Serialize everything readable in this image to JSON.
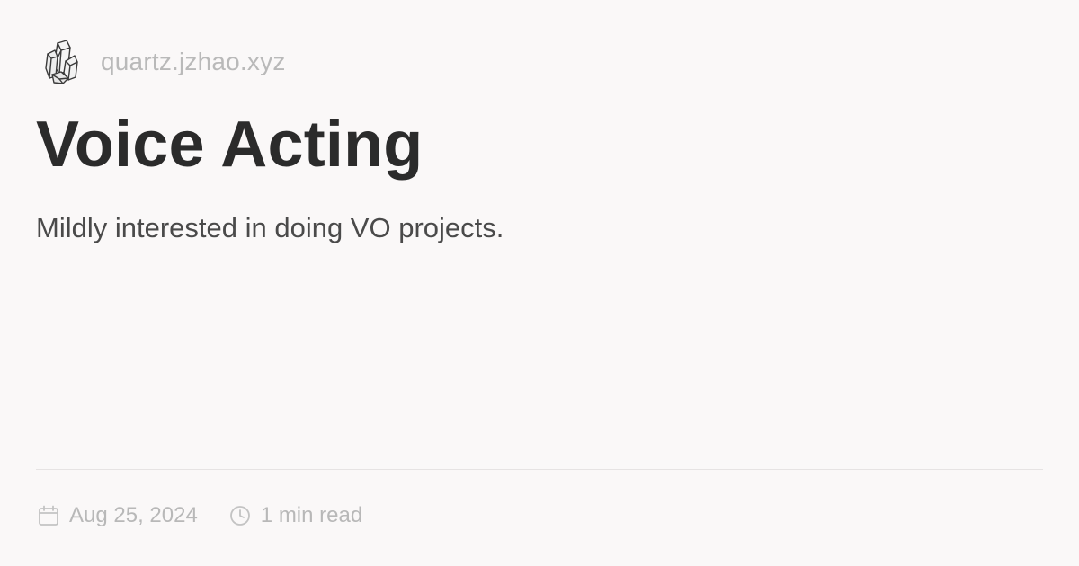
{
  "site": {
    "name": "quartz.jzhao.xyz",
    "logo_icon": "crystal-cluster-icon"
  },
  "page": {
    "title": "Voice Acting",
    "description": "Mildly interested in doing VO projects."
  },
  "meta": {
    "date": "Aug 25, 2024",
    "date_icon": "calendar-icon",
    "reading_time": "1 min read",
    "reading_time_icon": "clock-icon"
  },
  "colors": {
    "background": "#faf8f8",
    "title": "#2b2b2b",
    "body_text": "#4a4a4a",
    "muted_text": "#b8b8b8",
    "divider": "#e6e3e3"
  }
}
